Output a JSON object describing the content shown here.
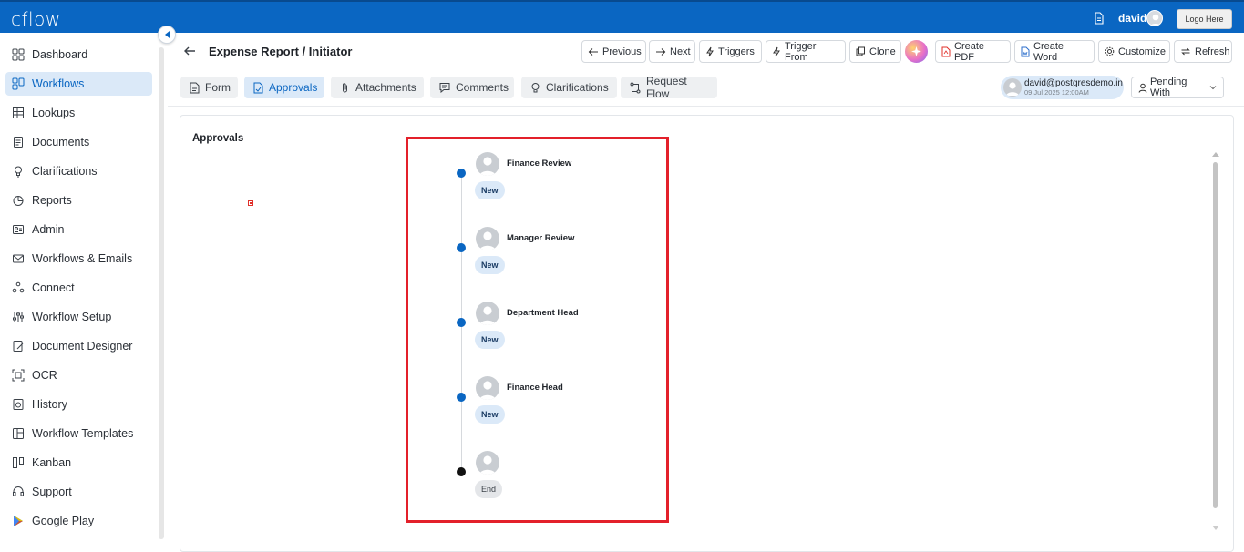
{
  "app": {
    "logo_text": "cflow",
    "user_name": "david",
    "logo_button": "Logo Here"
  },
  "sidebar": {
    "items": [
      {
        "label": "Dashboard",
        "icon": "dashboard-icon"
      },
      {
        "label": "Workflows",
        "icon": "workflows-icon",
        "active": true
      },
      {
        "label": "Lookups",
        "icon": "table-icon"
      },
      {
        "label": "Documents",
        "icon": "document-icon"
      },
      {
        "label": "Clarifications",
        "icon": "bulb-icon"
      },
      {
        "label": "Reports",
        "icon": "pie-chart-icon"
      },
      {
        "label": "Admin",
        "icon": "admin-icon"
      },
      {
        "label": "Workflows & Emails",
        "icon": "mail-icon"
      },
      {
        "label": "Connect",
        "icon": "connect-icon"
      },
      {
        "label": "Workflow Setup",
        "icon": "sliders-icon"
      },
      {
        "label": "Document Designer",
        "icon": "designer-icon"
      },
      {
        "label": "OCR",
        "icon": "ocr-icon"
      },
      {
        "label": "History",
        "icon": "history-icon"
      },
      {
        "label": "Workflow Templates",
        "icon": "templates-icon"
      },
      {
        "label": "Kanban",
        "icon": "kanban-icon"
      },
      {
        "label": "Support",
        "icon": "headset-icon"
      },
      {
        "label": "Google Play",
        "icon": "google-play-icon"
      }
    ]
  },
  "header": {
    "title": "Expense Report / Initiator",
    "buttons": {
      "previous": "Previous",
      "next": "Next",
      "triggers": "Triggers",
      "trigger_from": "Trigger From",
      "clone": "Clone",
      "create_pdf": "Create PDF",
      "create_word": "Create Word",
      "customize": "Customize",
      "refresh": "Refresh"
    }
  },
  "tabs": [
    {
      "label": "Form"
    },
    {
      "label": "Approvals",
      "active": true
    },
    {
      "label": "Attachments"
    },
    {
      "label": "Comments"
    },
    {
      "label": "Clarifications"
    },
    {
      "label": "Request Flow"
    }
  ],
  "assignee": {
    "email": "david@postgresdemo.in",
    "date": "09 Jul 2025 12:00AM"
  },
  "pending_with": "Pending With",
  "approvals": {
    "heading": "Approvals",
    "steps": [
      {
        "name": "Finance Review",
        "status": "New"
      },
      {
        "name": "Manager Review",
        "status": "New"
      },
      {
        "name": "Department Head",
        "status": "New"
      },
      {
        "name": "Finance Head",
        "status": "New"
      },
      {
        "name": "",
        "status": "End"
      }
    ]
  },
  "colors": {
    "brand": "#0a66c2",
    "highlight": "#e3202a",
    "active_bg": "#dbe9f8"
  }
}
